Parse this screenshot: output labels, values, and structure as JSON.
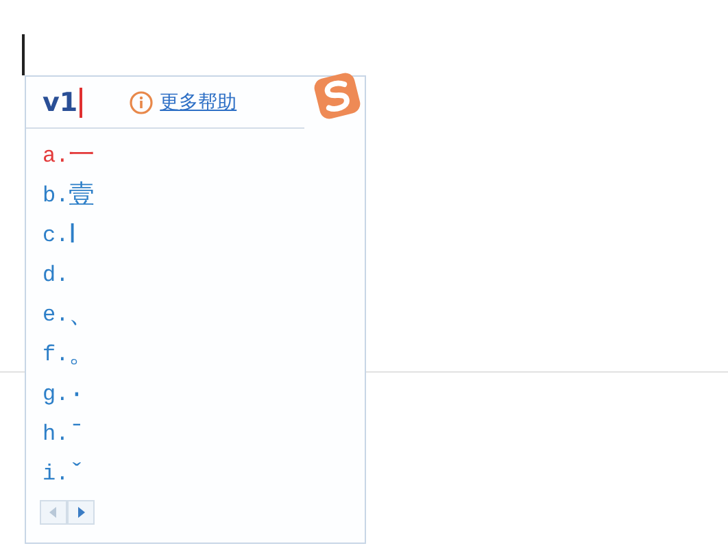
{
  "ime": {
    "composition": "v1",
    "help_link": "更多帮助",
    "candidates": [
      {
        "label": "a.",
        "text": "一",
        "selected": true
      },
      {
        "label": "b.",
        "text": "壹",
        "selected": false
      },
      {
        "label": "c.",
        "text": "Ⅰ",
        "selected": false
      },
      {
        "label": "d.",
        "selected": false
      },
      {
        "label": "e.",
        "text": "、",
        "selected": false
      },
      {
        "label": "f.",
        "text": "。",
        "selected": false
      },
      {
        "label": "g.",
        "text": "·",
        "selected": false
      },
      {
        "label": "h.",
        "text": "ˉ",
        "selected": false
      },
      {
        "label": "i.",
        "text": "ˇ",
        "selected": false
      }
    ],
    "pager": {
      "prev_disabled": true,
      "next_disabled": false
    }
  }
}
